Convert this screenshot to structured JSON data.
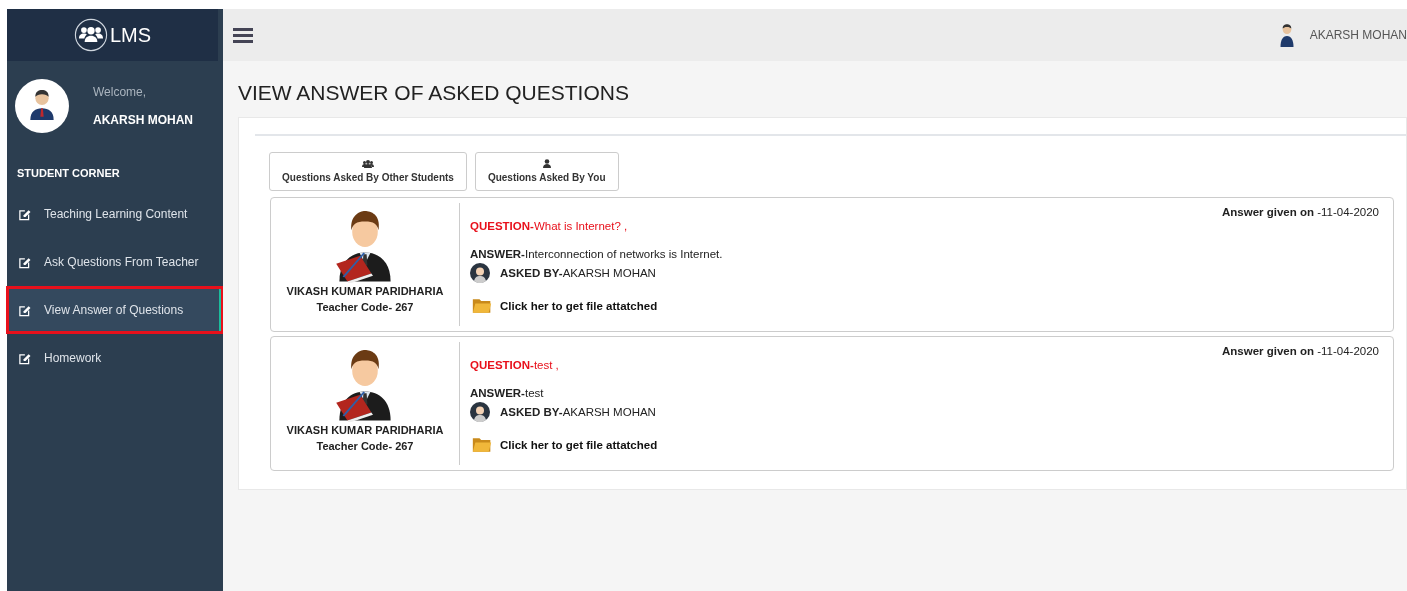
{
  "brand": {
    "title": "LMS"
  },
  "topbar": {
    "user_name": "AKARSH MOHAN"
  },
  "sidebar": {
    "welcome": "Welcome,",
    "user_name": "AKARSH MOHAN",
    "section": "STUDENT CORNER",
    "items": [
      {
        "label": "Teaching Learning Content",
        "selected": false,
        "annotated": false
      },
      {
        "label": "Ask Questions From Teacher",
        "selected": false,
        "annotated": false
      },
      {
        "label": "View Answer of Questions",
        "selected": true,
        "annotated": true
      },
      {
        "label": "Homework",
        "selected": false,
        "annotated": false
      }
    ]
  },
  "page": {
    "title": "VIEW ANSWER OF ASKED QUESTIONS",
    "filters": [
      {
        "label": "Questions Asked By Other Students",
        "kind": "group"
      },
      {
        "label": "Questions Asked By You",
        "kind": "user"
      }
    ],
    "answers": [
      {
        "teacher": "VIKASH KUMAR PARIDHARIA",
        "teacher_code": "Teacher Code- 267",
        "date": "**Answer given on** -11-04-2020",
        "question": "**QUESTION-**What is Internet? ,",
        "answer": "**ANSWER-**Interconnection of networks is Internet.",
        "asked_by": "**ASKED BY-**AKARSH MOHAN",
        "file_link": "Click her to get file attatched"
      },
      {
        "teacher": "VIKASH KUMAR PARIDHARIA",
        "teacher_code": "Teacher Code- 267",
        "date": "**Answer given on** -11-04-2020",
        "question": "**QUESTION-**test ,",
        "answer": "**ANSWER-**test",
        "asked_by": "**ASKED BY-**AKARSH MOHAN",
        "file_link": "Click her to get file attatched"
      }
    ]
  }
}
